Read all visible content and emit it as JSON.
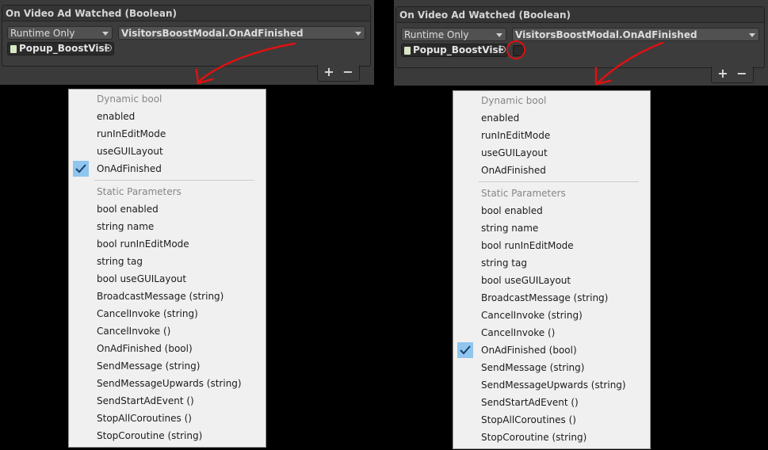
{
  "colors": {
    "panel_bg": "#3a3a3a",
    "menu_bg": "#f0f0f0",
    "check_bg": "#90c5ee",
    "arrow_red": "#e01010"
  },
  "left": {
    "event_title": "On Video Ad Watched (Boolean)",
    "mode_value": "Runtime Only",
    "function_value": "VisitorsBoostModal.OnAdFinished",
    "object_field": "Popup_BoostVisi",
    "add_label": "+",
    "remove_label": "−",
    "menu": [
      {
        "label": "Dynamic bool",
        "header": true
      },
      {
        "label": "enabled"
      },
      {
        "label": "runInEditMode"
      },
      {
        "label": "useGUILayout"
      },
      {
        "label": "OnAdFinished",
        "checked": true
      },
      {
        "separator": true
      },
      {
        "label": "Static Parameters",
        "header": true
      },
      {
        "label": "bool enabled"
      },
      {
        "label": "string name"
      },
      {
        "label": "bool runInEditMode"
      },
      {
        "label": "string tag"
      },
      {
        "label": "bool useGUILayout"
      },
      {
        "label": "BroadcastMessage (string)"
      },
      {
        "label": "CancelInvoke (string)"
      },
      {
        "label": "CancelInvoke ()"
      },
      {
        "label": "OnAdFinished (bool)"
      },
      {
        "label": "SendMessage (string)"
      },
      {
        "label": "SendMessageUpwards (string)"
      },
      {
        "label": "SendStartAdEvent ()"
      },
      {
        "label": "StopAllCoroutines ()"
      },
      {
        "label": "StopCoroutine (string)"
      }
    ]
  },
  "right": {
    "event_title": "On Video Ad Watched (Boolean)",
    "mode_value": "Runtime Only",
    "function_value": "VisitorsBoostModal.OnAdFinished",
    "object_field": "Popup_BoostVisi",
    "bool_checkbox_checked": false,
    "add_label": "+",
    "remove_label": "−",
    "menu": [
      {
        "label": "Dynamic bool",
        "header": true
      },
      {
        "label": "enabled"
      },
      {
        "label": "runInEditMode"
      },
      {
        "label": "useGUILayout"
      },
      {
        "label": "OnAdFinished"
      },
      {
        "separator": true
      },
      {
        "label": "Static Parameters",
        "header": true
      },
      {
        "label": "bool enabled"
      },
      {
        "label": "string name"
      },
      {
        "label": "bool runInEditMode"
      },
      {
        "label": "string tag"
      },
      {
        "label": "bool useGUILayout"
      },
      {
        "label": "BroadcastMessage (string)"
      },
      {
        "label": "CancelInvoke (string)"
      },
      {
        "label": "CancelInvoke ()"
      },
      {
        "label": "OnAdFinished (bool)",
        "checked": true
      },
      {
        "label": "SendMessage (string)"
      },
      {
        "label": "SendMessageUpwards (string)"
      },
      {
        "label": "SendStartAdEvent ()"
      },
      {
        "label": "StopAllCoroutines ()"
      },
      {
        "label": "StopCoroutine (string)"
      }
    ]
  }
}
